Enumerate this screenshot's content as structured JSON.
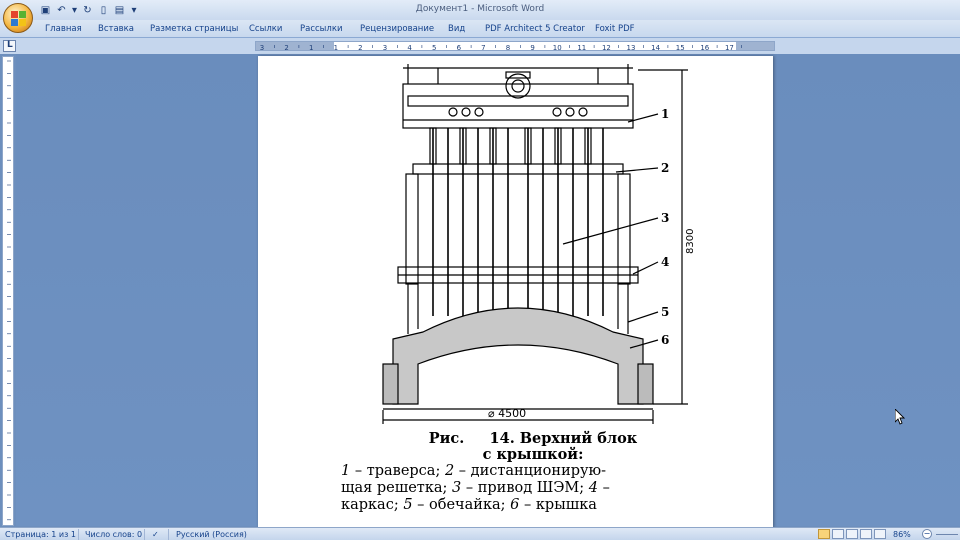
{
  "window": {
    "title": "Документ1 - Microsoft Word"
  },
  "quick_access": [
    "save-icon",
    "undo-icon",
    "redo-icon",
    "new-document-icon",
    "print-preview-icon",
    "customize-dropdown-icon"
  ],
  "ribbon": {
    "tabs": [
      {
        "label": "Главная"
      },
      {
        "label": "Вставка"
      },
      {
        "label": "Разметка страницы"
      },
      {
        "label": "Ссылки"
      },
      {
        "label": "Рассылки"
      },
      {
        "label": "Рецензирование"
      },
      {
        "label": "Вид"
      },
      {
        "label": "PDF Architect 5 Creator"
      },
      {
        "label": "Foxit PDF"
      }
    ]
  },
  "ruler": {
    "labels": [
      "3",
      "2",
      "1",
      "1",
      "2",
      "3",
      "4",
      "5",
      "6",
      "7",
      "8",
      "9",
      "10",
      "11",
      "12",
      "13",
      "14",
      "15",
      "16",
      "17"
    ]
  },
  "figure": {
    "callouts": [
      "1",
      "2",
      "3",
      "4",
      "5",
      "6"
    ],
    "height_label": "8300",
    "diameter_label": "⌀ 4500"
  },
  "caption": {
    "title_line1": "Рис.     14. Верхний блок",
    "title_line2": "с крышкой:",
    "n1": "1",
    "t1": " – траверса; ",
    "n2": "2",
    "t2": " – дистанционирую-",
    "line2_a": "щая решетка; ",
    "n3": "3",
    "t3": " – привод ШЭМ; ",
    "n4": "4",
    "t4": " –",
    "line3_a": "каркас; ",
    "n5": "5",
    "t5": " – обечайка; ",
    "n6": "6",
    "t6": " – крышка"
  },
  "status": {
    "page": "Страница: 1 из 1",
    "words": "Число слов: 0",
    "language": "Русский (Россия)",
    "zoom": "86%"
  },
  "colors": {
    "page_background": "#ffffff",
    "workspace": "#6d8fbd",
    "chrome": "#c7d8ee"
  }
}
